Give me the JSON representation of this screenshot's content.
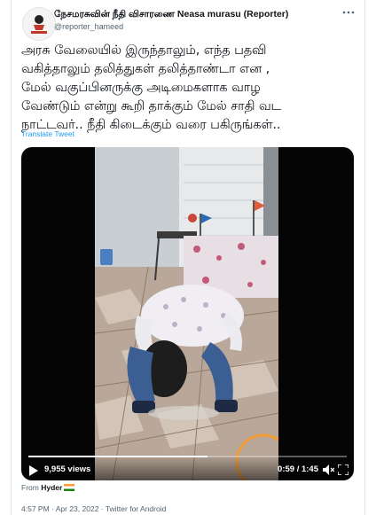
{
  "header": {
    "display_name": "நேசமரசுவின் நீதி விசாரணை Neasa murasu (Reporter)",
    "handle": "@reporter_hameed",
    "more_icon": "more-icon"
  },
  "tweet": {
    "text": "அரசு வேலையில் இருந்தாலும், எந்த பதவி\nவகித்தாலும் தலித்துகள் தலித்தாண்டா என  ,\nமேல் வகுப்பினருக்கு அடிமைகளாக வாழ\nவேண்டும் என்று கூறி தாக்கும் மேல் சாதி வட\nநாட்டவர்.. நீதி கிடைக்கும் வரை பகிருங்கள்..",
    "translate_label": "Translate Tweet"
  },
  "video": {
    "views": "9,955 views",
    "time": "0:59 / 1:45",
    "progress_fraction": 0.562
  },
  "footer": {
    "from_label": "From",
    "from_user": "Hyder",
    "timestamp": "4:57 PM · Apr 23, 2022 · Twitter for Android"
  },
  "colors": {
    "accent": "#1d9bf0",
    "text": "#0f1419",
    "secondary": "#536471"
  }
}
